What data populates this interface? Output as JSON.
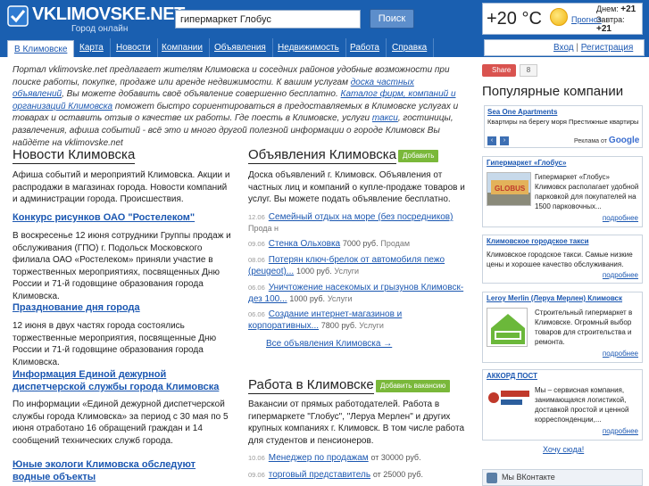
{
  "header": {
    "logo_name": "VKLIMOVSKE.NET",
    "logo_tagline": "Город онлайн",
    "search_value": "гипермаркет Глобус",
    "search_button": "Поиск"
  },
  "weather": {
    "temp": "+20 °C",
    "forecast_link": "Прогноз",
    "day_label": "Днем:",
    "day_temp": "+21",
    "tomorrow_label": "Завтра:",
    "tomorrow_temp": "+21"
  },
  "nav": {
    "items": [
      "В Климовске",
      "Карта",
      "Новости",
      "Компании",
      "Объявления",
      "Недвижимость",
      "Работа",
      "Справка"
    ]
  },
  "auth": {
    "login": "Вход",
    "separator": "|",
    "register": "Регистрация"
  },
  "intro": {
    "p1": "Портал vklimovske.net предлагает жителям Климовска и соседних районов удобные возможности при поиске работы, покупке, продаже или аренде недвижимости. К вашим услугам ",
    "link1": "доска частных объявлений",
    "p2": ", Вы можете добавить своё объявление совершенно бесплатно. ",
    "link2": "Каталог фирм, компаний и организаций Климовска",
    "p3": " поможет быстро сориентироваться в предоставляемых в Климовске услугах и товарах и оставить отзыв о качестве их работы. Где поесть в Климовске, услуги ",
    "link3": "такси",
    "p4": ", гостиницы, развлечения, афиша событий - всё это и много другой полезной информации о городе Климовск Вы найдёте на vklimovske.net"
  },
  "news": {
    "title": "Новости Климовска",
    "desc": "Афиша событий и мероприятий Климовска. Акции и распродажи в магазинах города. Новости компаний и администрации города. Происшествия.",
    "items": [
      {
        "title": "Конкурс рисунков ОАО \"Ростелеком\"",
        "text": "В воскресенье 12 июня сотрудники Группы продаж и обслуживания (ГПО) г. Подольск Московского филиала ОАО «Ростелеком» приняли участие в торжественных мероприятиях, посвященных Дню России и 71-й годовщине образования города Климовска."
      },
      {
        "title": "Празднование дня города",
        "text": "12 июня в двух частях города состоялись торжественные мероприятия, посвященные Дню России и 71-й годовщине образования города Климовска."
      },
      {
        "title": "Информация Единой дежурной диспетчерской службы города Климовска",
        "text": "По информации «Единой дежурной диспетчерской службы города Климовска» за период с 30 мая по 5 июня отработано 16 обращений граждан и 14 сообщений технических служб города."
      },
      {
        "title": "Юные экологи Климовска обследуют водные объекты",
        "text": ""
      }
    ]
  },
  "ads": {
    "title": "Объявления Климовска",
    "badge": "Добавить",
    "desc": "Доска объявлений г. Климовск. Объявления от частных лиц и компаний о купле-продаже товаров и услуг. Вы можете подать объявление бесплатно.",
    "items": [
      {
        "date": "12.06",
        "title": "Семейный отдых на море (без посредников)",
        "price": "",
        "kind": "Прода н"
      },
      {
        "date": "09.06",
        "title": "Стенка Ольховка",
        "price": "7000 руб.",
        "kind": "Продам"
      },
      {
        "date": "08.06",
        "title": "Потерян ключ-брелок от автомобиля пежо (peugeot)...",
        "price": "1000 руб.",
        "kind": "Услуги"
      },
      {
        "date": "06.06",
        "title": "Уничтожение насекомых и грызунов Климовск-дез 100...",
        "price": "1000 руб.",
        "kind": "Услуги"
      },
      {
        "date": "06.06",
        "title": "Создание интернет-магазинов и корпоративных...",
        "price": "7800 руб.",
        "kind": "Услуги"
      }
    ],
    "all_link": "Все объявления Климовска →"
  },
  "jobs": {
    "title": "Работа в Климовске",
    "badge": "Добавить вакансию",
    "desc": "Вакансии от прямых работодателей. Работа в гипермаркете \"Глобус\", \"Леруа Мерлен\" и других крупных компаниях г. Климовск. В том числе работа для студентов и пенсионеров.",
    "items": [
      {
        "date": "10.06",
        "title": "Менеджер по продажам",
        "price": "от 30000 руб."
      },
      {
        "date": "09.06",
        "title": "торговый представитель",
        "price": "от 25000 руб."
      }
    ]
  },
  "sidebar": {
    "share_label": "Share",
    "share_count": "8",
    "popular_title": "Популярные компании",
    "ad": {
      "head": "Sea One Apartments",
      "text": "Квартиры на берегу моря Престижные квартиры",
      "google_label": "Реклама от",
      "google_brand": "Google"
    },
    "companies": [
      {
        "name": "Гипермаркет «Глобус»",
        "text": "Гипермаркет «Глобус» Климовск располагает удобной парковкой для покупателей на 1500 парковочных...",
        "more": "подробнее"
      },
      {
        "name": "Климовское городское такси",
        "text": "Климовское городское такси. Самые низкие цены и хорошее качество обслуживания.",
        "more": "подробнее"
      },
      {
        "name": "Leroy Merlin (Леруа Мерлен) Климовск",
        "text": "Строительный гипермаркет в Климовске. Огромный выбор товаров для строительства и ремонта.",
        "more": "подробнее"
      },
      {
        "name": "АККОРД ПОСТ",
        "text": "Мы – сервисная компания, занимающаяся логистикой, доставкой простой и ценной корреспонденции,...",
        "more": "подробнее"
      }
    ],
    "hint_link": "Хочу сюда!",
    "vk_label": "Мы ВКонтакте"
  },
  "colors": {
    "brand_blue": "#1a5fb0",
    "link": "#1b57b1",
    "badge_green": "#7ab83a"
  }
}
